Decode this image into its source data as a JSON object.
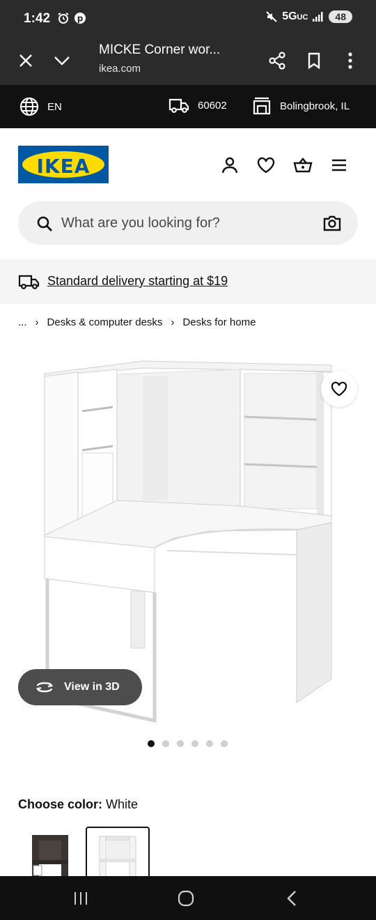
{
  "status": {
    "time": "1:42",
    "network": "5G",
    "network_suffix": "UC",
    "battery": "48"
  },
  "browser": {
    "title": "MICKE Corner wor...",
    "url": "ikea.com"
  },
  "locale_bar": {
    "language": "EN",
    "zip": "60602",
    "store": "Bolingbrook, IL"
  },
  "logo": {
    "text": "IKEA",
    "colors": {
      "blue": "#0058a3",
      "yellow": "#ffdb00"
    }
  },
  "header_icons": [
    "user-icon",
    "heart-icon",
    "basket-icon",
    "hamburger-menu-icon"
  ],
  "search": {
    "placeholder": "What are you looking for?"
  },
  "delivery": {
    "text": "Standard delivery starting at $19"
  },
  "breadcrumb": {
    "ellipsis": "...",
    "items": [
      "Desks & computer desks",
      "Desks for home"
    ]
  },
  "product": {
    "view_3d_label": "View in 3D",
    "image_count": 6,
    "active_image": 1
  },
  "color": {
    "label": "Choose color:",
    "value": "White",
    "options": [
      "Black-brown",
      "White"
    ],
    "selected": "White"
  }
}
